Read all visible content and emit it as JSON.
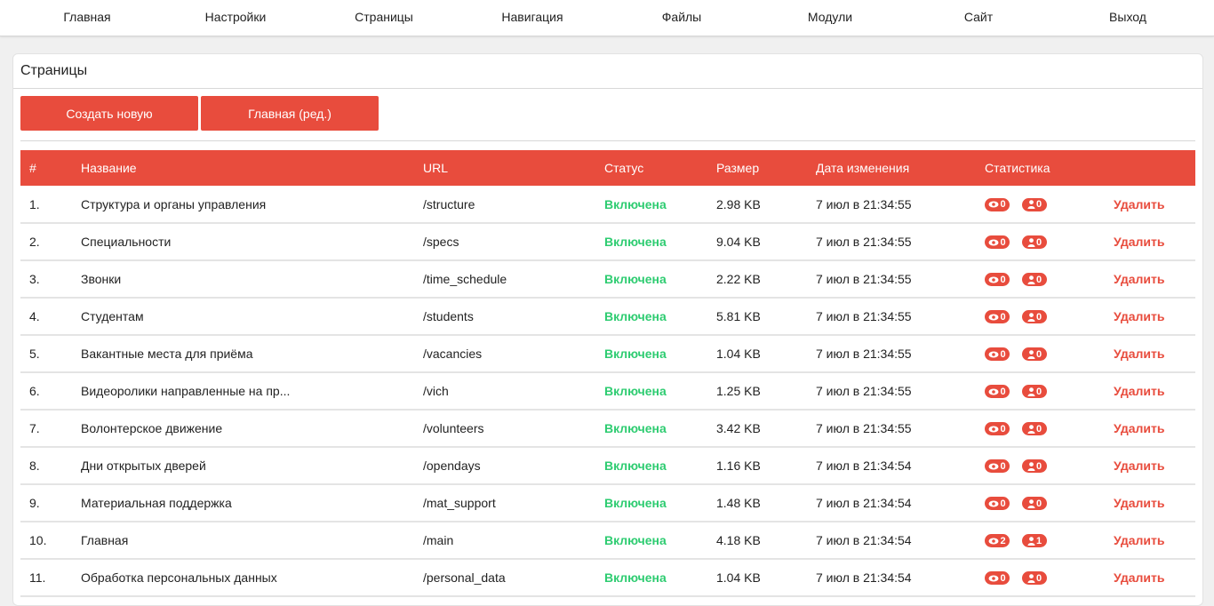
{
  "nav": [
    "Главная",
    "Настройки",
    "Страницы",
    "Навигация",
    "Файлы",
    "Модули",
    "Сайт",
    "Выход"
  ],
  "panel": {
    "title": "Страницы",
    "create_button": "Создать новую",
    "edit_main_button": "Главная (ред.)"
  },
  "table": {
    "headers": [
      "#",
      "Название",
      "URL",
      "Статус",
      "Размер",
      "Дата изменения",
      "Статистика",
      ""
    ],
    "rows": [
      {
        "num": "1.",
        "name": "Структура и органы управления",
        "url": "/structure",
        "status": "Включена",
        "size": "2.98 KB",
        "date": "7 июл в 21:34:55",
        "views": "0",
        "users": "0",
        "delete": "Удалить"
      },
      {
        "num": "2.",
        "name": "Специальности",
        "url": "/specs",
        "status": "Включена",
        "size": "9.04 KB",
        "date": "7 июл в 21:34:55",
        "views": "0",
        "users": "0",
        "delete": "Удалить"
      },
      {
        "num": "3.",
        "name": "Звонки",
        "url": "/time_schedule",
        "status": "Включена",
        "size": "2.22 KB",
        "date": "7 июл в 21:34:55",
        "views": "0",
        "users": "0",
        "delete": "Удалить"
      },
      {
        "num": "4.",
        "name": "Студентам",
        "url": "/students",
        "status": "Включена",
        "size": "5.81 KB",
        "date": "7 июл в 21:34:55",
        "views": "0",
        "users": "0",
        "delete": "Удалить"
      },
      {
        "num": "5.",
        "name": "Вакантные места для приёма",
        "url": "/vacancies",
        "status": "Включена",
        "size": "1.04 KB",
        "date": "7 июл в 21:34:55",
        "views": "0",
        "users": "0",
        "delete": "Удалить"
      },
      {
        "num": "6.",
        "name": "Видеоролики направленные на пр...",
        "url": "/vich",
        "status": "Включена",
        "size": "1.25 KB",
        "date": "7 июл в 21:34:55",
        "views": "0",
        "users": "0",
        "delete": "Удалить"
      },
      {
        "num": "7.",
        "name": "Волонтерское движение",
        "url": "/volunteers",
        "status": "Включена",
        "size": "3.42 KB",
        "date": "7 июл в 21:34:55",
        "views": "0",
        "users": "0",
        "delete": "Удалить"
      },
      {
        "num": "8.",
        "name": "Дни открытых дверей",
        "url": "/opendays",
        "status": "Включена",
        "size": "1.16 KB",
        "date": "7 июл в 21:34:54",
        "views": "0",
        "users": "0",
        "delete": "Удалить"
      },
      {
        "num": "9.",
        "name": "Материальная поддержка",
        "url": "/mat_support",
        "status": "Включена",
        "size": "1.48 KB",
        "date": "7 июл в 21:34:54",
        "views": "0",
        "users": "0",
        "delete": "Удалить"
      },
      {
        "num": "10.",
        "name": "Главная",
        "url": "/main",
        "status": "Включена",
        "size": "4.18 KB",
        "date": "7 июл в 21:34:54",
        "views": "2",
        "users": "1",
        "delete": "Удалить"
      },
      {
        "num": "11.",
        "name": "Обработка персональных данных",
        "url": "/personal_data",
        "status": "Включена",
        "size": "1.04 KB",
        "date": "7 июл в 21:34:54",
        "views": "0",
        "users": "0",
        "delete": "Удалить"
      }
    ]
  },
  "colors": {
    "accent": "#e84c3d",
    "status_on": "#2ecc71",
    "background": "#f0f0f0"
  },
  "icons": {
    "views": "eye-icon",
    "users": "user-icon"
  }
}
